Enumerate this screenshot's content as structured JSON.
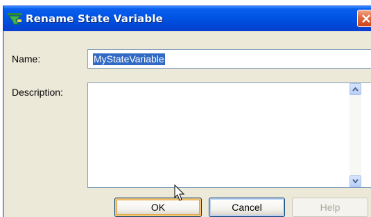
{
  "window": {
    "title": "Rename State Variable"
  },
  "icons": {
    "app": "state-variable-icon",
    "close": "close-icon",
    "scroll_up": "scroll-up-icon",
    "scroll_down": "scroll-down-icon",
    "cursor": "mouse-pointer-icon"
  },
  "form": {
    "name_label": "Name:",
    "name_value": "MyStateVariable",
    "description_label": "Description:",
    "description_value": ""
  },
  "buttons": {
    "ok": "OK",
    "cancel": "Cancel",
    "help": "Help"
  },
  "colors": {
    "titlebar": "#0054e3",
    "selection": "#316ac5",
    "dialog_bg": "#ece9d8"
  }
}
